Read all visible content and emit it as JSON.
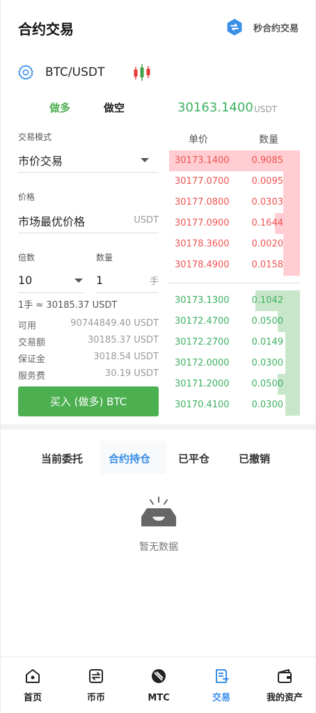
{
  "header": {
    "title": "合约交易",
    "quick_trade_label": "秒合约交易"
  },
  "pair": {
    "name": "BTC/USDT"
  },
  "direction": {
    "long_label": "做多",
    "short_label": "做空"
  },
  "last_price": {
    "value": "30163.1400",
    "unit": "USDT"
  },
  "form": {
    "mode_label": "交易模式",
    "mode_value": "市价交易",
    "price_label": "价格",
    "price_value": "市场最优价格",
    "price_unit": "USDT",
    "leverage_label": "倍数",
    "leverage_value": "10",
    "qty_label": "数量",
    "qty_value": "1",
    "qty_unit": "手",
    "lot_note": "1手 ≈ 30185.37 USDT",
    "info": [
      {
        "label": "可用",
        "value": "90744849.40 USDT"
      },
      {
        "label": "交易额",
        "value": "30185.37 USDT"
      },
      {
        "label": "保证金",
        "value": "3018.54 USDT"
      },
      {
        "label": "服务费",
        "value": "30.19 USDT"
      }
    ],
    "buy_label": "买入 (做多) BTC"
  },
  "orderbook": {
    "price_header": "单价",
    "qty_header": "数量",
    "asks": [
      {
        "price": "30173.1400",
        "qty": "0.9085",
        "depth": 1.0
      },
      {
        "price": "30177.0700",
        "qty": "0.0095",
        "depth": 0.13
      },
      {
        "price": "30177.0800",
        "qty": "0.0303",
        "depth": 0.13
      },
      {
        "price": "30177.0900",
        "qty": "0.1644",
        "depth": 0.19
      },
      {
        "price": "30178.3600",
        "qty": "0.0020",
        "depth": 0.13
      },
      {
        "price": "30178.4900",
        "qty": "0.0158",
        "depth": 0.13
      }
    ],
    "bids": [
      {
        "price": "30173.1300",
        "qty": "0.1042",
        "depth": 0.34
      },
      {
        "price": "30172.4700",
        "qty": "0.0500",
        "depth": 0.17
      },
      {
        "price": "30172.2700",
        "qty": "0.0149",
        "depth": 0.11
      },
      {
        "price": "30172.0000",
        "qty": "0.0300",
        "depth": 0.11
      },
      {
        "price": "30171.2000",
        "qty": "0.0500",
        "depth": 0.17
      },
      {
        "price": "30170.4100",
        "qty": "0.0300",
        "depth": 0.11
      }
    ],
    "ask_color": "#ffcdd2",
    "bid_color": "#c8e6c9"
  },
  "order_tabs": [
    "当前委托",
    "合约持仓",
    "已平仓",
    "已撤销"
  ],
  "empty": {
    "text": "暂无数据"
  },
  "nav": [
    {
      "label": "首页",
      "icon": "home-icon"
    },
    {
      "label": "币币",
      "icon": "exchange-icon"
    },
    {
      "label": "MTC",
      "icon": "mtc-icon"
    },
    {
      "label": "交易",
      "icon": "trade-icon"
    },
    {
      "label": "我的资产",
      "icon": "wallet-icon"
    }
  ],
  "colors": {
    "accent": "#3b8fe6",
    "up": "#4caf50",
    "down": "#ef5350"
  }
}
